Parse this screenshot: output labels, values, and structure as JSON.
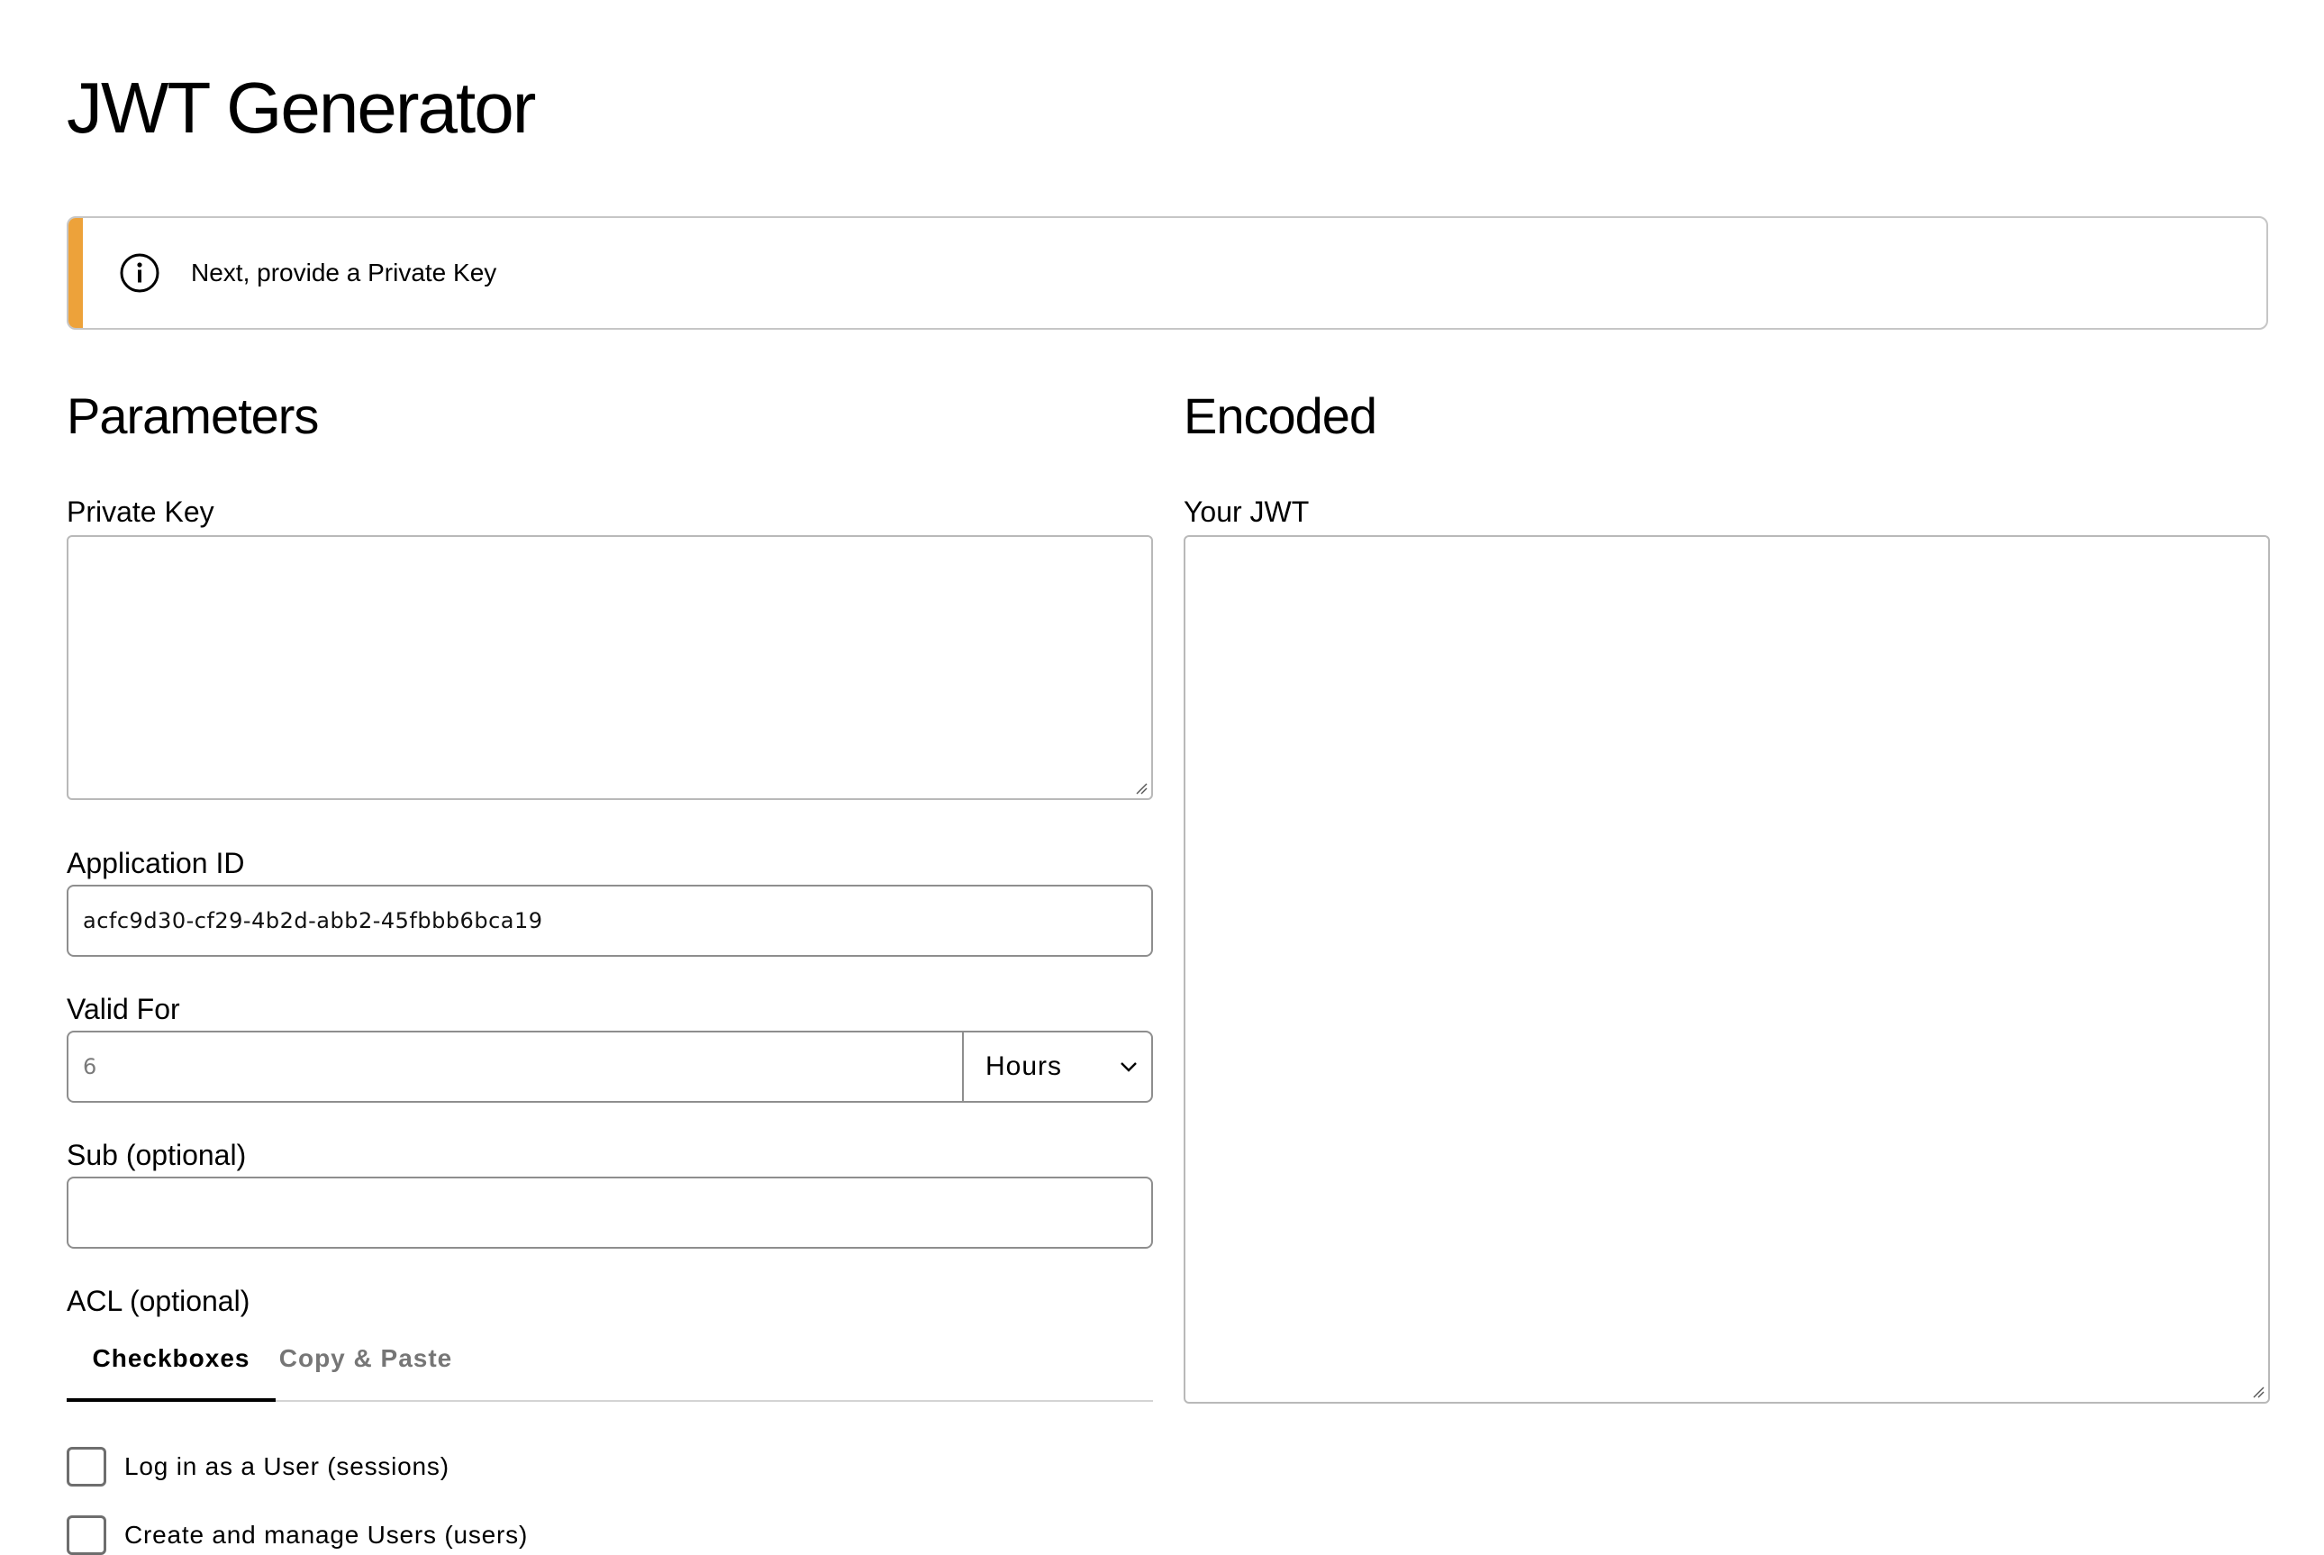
{
  "page": {
    "title": "JWT Generator"
  },
  "banner": {
    "icon": "info-circle-icon",
    "message": "Next, provide a Private Key",
    "accent_color": "#eda23a"
  },
  "parameters": {
    "title": "Parameters",
    "private_key": {
      "label": "Private Key",
      "value": ""
    },
    "application_id": {
      "label": "Application ID",
      "value": "acfc9d30-cf29-4b2d-abb2-45fbbb6bca19"
    },
    "valid_for": {
      "label": "Valid For",
      "placeholder": "6",
      "unit_selected": "Hours"
    },
    "sub": {
      "label": "Sub (optional)",
      "value": ""
    },
    "acl": {
      "label": "ACL (optional)",
      "tabs": [
        {
          "label": "Checkboxes",
          "active": true
        },
        {
          "label": "Copy & Paste",
          "active": false
        }
      ],
      "options": [
        {
          "label": "Log in as a User (sessions)",
          "checked": false
        },
        {
          "label": "Create and manage Users (users)",
          "checked": false
        }
      ]
    }
  },
  "encoded": {
    "title": "Encoded",
    "jwt": {
      "label": "Your JWT",
      "value": ""
    }
  }
}
